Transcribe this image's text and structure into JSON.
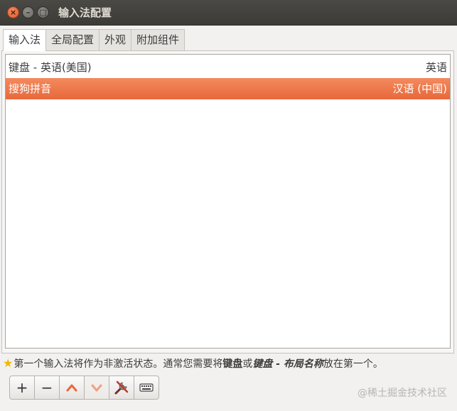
{
  "window": {
    "title": "输入法配置"
  },
  "tabs": [
    {
      "label": "输入法",
      "active": true
    },
    {
      "label": "全局配置",
      "active": false
    },
    {
      "label": "外观",
      "active": false
    },
    {
      "label": "附加组件",
      "active": false
    }
  ],
  "input_methods": [
    {
      "name": "键盘 - 英语(美国)",
      "language": "英语",
      "selected": false
    },
    {
      "name": "搜狗拼音",
      "language": "汉语 (中国)",
      "selected": true
    }
  ],
  "hint": {
    "icon": "star-icon",
    "part1": "第一个输入法将作为非激活状态。通常您需要将",
    "bold1": "键盘",
    "part2": "或",
    "bold2": "键盘 - 布局名称",
    "part3": "放在第一个。"
  },
  "toolbar": {
    "add_label": "+",
    "remove_label": "−",
    "up_icon": "chevron-up-icon",
    "down_icon": "chevron-down-icon",
    "configure_icon": "configure-icon",
    "keyboard_icon": "keyboard-layout-icon"
  },
  "watermark": "@稀土掘金技术社区",
  "colors": {
    "selection": "#e8683a",
    "titlebar": "#3c3b37",
    "accent_up": "#e8683a",
    "accent_down": "#f0a080"
  }
}
